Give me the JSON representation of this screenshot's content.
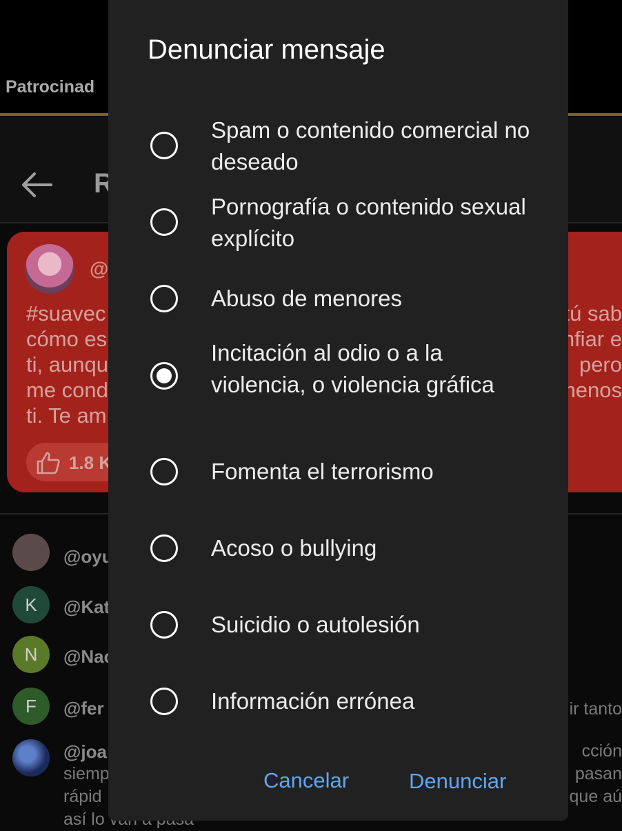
{
  "background": {
    "sponsor_tab": "Patrocinad",
    "appbar_title_fragment": "R",
    "post": {
      "handle_fragment": "@",
      "text_left": [
        "#suavec",
        "cómo es",
        "ti, aunqu",
        "me cond",
        "ti. Te am"
      ],
      "text_right": [
        "tú sab",
        "nfiar e",
        "pero",
        "menos"
      ],
      "likes": "1.8 K"
    },
    "comments": [
      {
        "avatar_letter": "",
        "handle": "@oyu",
        "avatar_color": "#5a4a4a",
        "text_right": ""
      },
      {
        "avatar_letter": "K",
        "handle": "@Kat",
        "avatar_color": "#1f4a3a",
        "text_right": ""
      },
      {
        "avatar_letter": "N",
        "handle": "@Nac",
        "avatar_color": "#5a7a2a",
        "text_right": ""
      },
      {
        "avatar_letter": "F",
        "handle": "@fer",
        "avatar_color": "#2f5a2a",
        "text_right": "ir tanto"
      },
      {
        "avatar_letter": "",
        "handle": "@joa",
        "avatar_color": "#1a2a5a",
        "text_left": [
          "siemp",
          "rápid",
          "así lo van a pasa"
        ],
        "text_right": [
          "cción",
          "pasan",
          "que aú"
        ]
      }
    ]
  },
  "dialog": {
    "title": "Denunciar mensaje",
    "options": [
      {
        "label": "Spam o contenido comercial no deseado",
        "checked": false
      },
      {
        "label": "Pornografía o contenido sexual explícito",
        "checked": false
      },
      {
        "label": "Abuso de menores",
        "checked": false
      },
      {
        "label": "Incitación al odio o a la violencia, o violencia gráfica",
        "checked": true
      },
      {
        "label": "Fomenta el terrorismo",
        "checked": false
      },
      {
        "label": "Acoso o bullying",
        "checked": false
      },
      {
        "label": "Suicidio o autolesión",
        "checked": false
      },
      {
        "label": "Información errónea",
        "checked": false
      }
    ],
    "cancel_label": "Cancelar",
    "submit_label": "Denunciar"
  },
  "colors": {
    "dialog_bg": "#212121",
    "accent": "#5ea6ef",
    "post_card": "#a3221c",
    "sponsor_underline": "#7a6326"
  }
}
